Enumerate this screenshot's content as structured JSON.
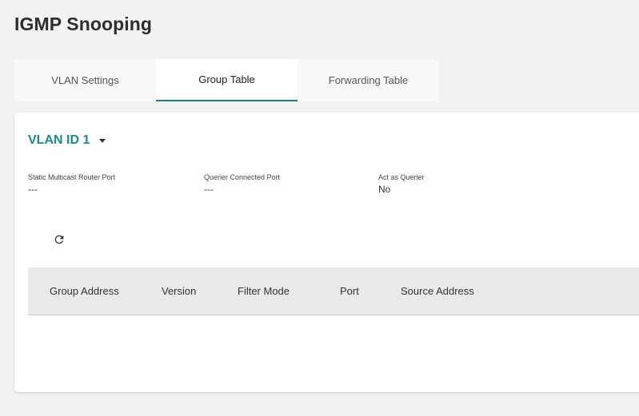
{
  "page": {
    "title": "IGMP Snooping"
  },
  "tabs": [
    {
      "label": "VLAN Settings"
    },
    {
      "label": "Group Table"
    },
    {
      "label": "Forwarding Table"
    }
  ],
  "vlan": {
    "selected": "VLAN ID 1"
  },
  "info": {
    "static_multicast_router_port": {
      "label": "Static Multicast Router Port",
      "value": "---"
    },
    "querier_connected_port": {
      "label": "Querier Connected Port",
      "value": "---"
    },
    "act_as_querier": {
      "label": "Act as Querier",
      "value": "No"
    }
  },
  "toolbar": {
    "refresh_icon": "refresh-icon"
  },
  "table": {
    "columns": [
      "Group Address",
      "Version",
      "Filter Mode",
      "Port",
      "Source Address"
    ],
    "rows": []
  },
  "colors": {
    "accent": "#1a8a8a",
    "tab_indicator": "#1a7f80",
    "background": "#f2f2f2",
    "table_header": "#e9e9e9"
  }
}
